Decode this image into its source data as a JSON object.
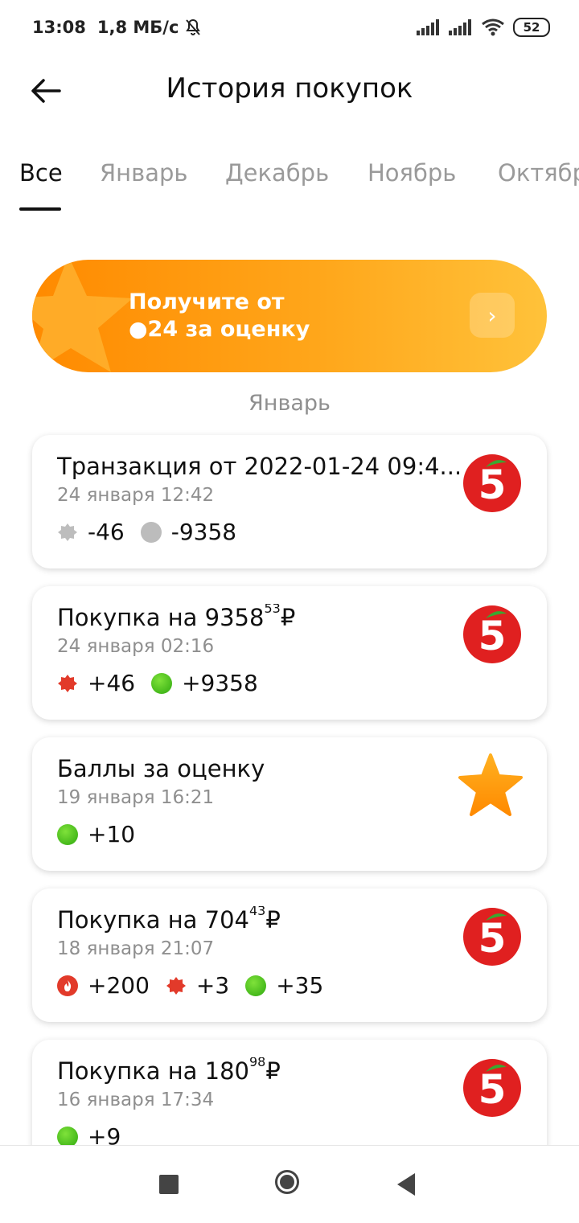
{
  "status_bar": {
    "time": "13:08",
    "speed": "1,8 МБ/с",
    "battery": "52"
  },
  "header": {
    "title": "История покупок"
  },
  "tabs": [
    {
      "label": "Все",
      "active": true
    },
    {
      "label": "Январь",
      "active": false
    },
    {
      "label": "Декабрь",
      "active": false
    },
    {
      "label": "Ноябрь",
      "active": false
    },
    {
      "label": "Октябрь",
      "active": false
    }
  ],
  "promo": {
    "line1": "Получите от",
    "line2": "●24 за оценку",
    "arrow": "›"
  },
  "section": {
    "month": "Январь"
  },
  "cards": [
    {
      "title": "Транзакция от 2022-01-24 09:4...",
      "date": "24 января 12:42",
      "logo": "5",
      "points": [
        {
          "icon": "grey-badge-icon",
          "value": "-46"
        },
        {
          "icon": "grey-dot-icon",
          "value": "-9358"
        }
      ]
    },
    {
      "title_prefix": "Покупка на 9358",
      "title_kopecks": "53",
      "currency": "₽",
      "date": "24 января 02:16",
      "logo": "5",
      "points": [
        {
          "icon": "red-badge-icon",
          "value": "+46"
        },
        {
          "icon": "green-dot-icon",
          "value": "+9358"
        }
      ]
    },
    {
      "title": "Баллы за оценку",
      "date": "19 января 16:21",
      "icon": "star-icon",
      "points": [
        {
          "icon": "green-dot-icon",
          "value": "+10"
        }
      ]
    },
    {
      "title_prefix": "Покупка на 704",
      "title_kopecks": "43",
      "currency": "₽",
      "date": "18 января 21:07",
      "logo": "5",
      "points": [
        {
          "icon": "fire-icon",
          "value": "+200"
        },
        {
          "icon": "red-badge-icon",
          "value": "+3"
        },
        {
          "icon": "green-dot-icon",
          "value": "+35"
        }
      ]
    },
    {
      "title_prefix": "Покупка на 180",
      "title_kopecks": "98",
      "currency": "₽",
      "date": "16 января 17:34",
      "logo": "5",
      "points": [
        {
          "icon": "green-dot-icon",
          "value": "+9"
        }
      ]
    }
  ],
  "colors": {
    "accent_orange": "#ff8a00",
    "brand_red": "#e02020",
    "green": "#3cb816",
    "muted": "#8f8f8f"
  }
}
